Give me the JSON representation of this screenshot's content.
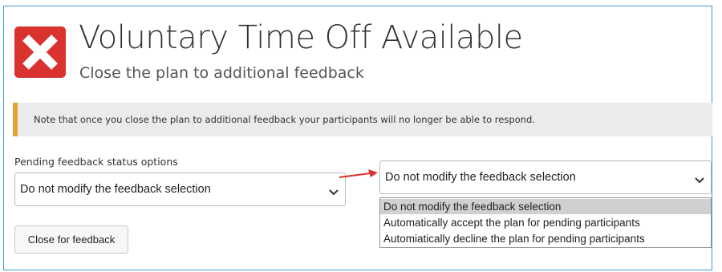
{
  "header": {
    "icon": "close-x-icon",
    "title": "Voluntary Time Off Available",
    "subtitle": "Close the plan to additional feedback"
  },
  "note": {
    "text": "Note that once you close the plan to additional feedback your participants will no longer be able to respond.",
    "accent_color": "#e0a52d"
  },
  "pending_feedback": {
    "label": "Pending feedback status options",
    "left_select_value": "Do not modify the feedback selection",
    "right_select_value": "Do not modify the feedback selection",
    "options": [
      "Do not modify the feedback selection",
      "Automatically accept the plan for pending participants",
      "Automiatically decline the plan for pending participants"
    ],
    "highlighted_option_index": 0
  },
  "actions": {
    "close_button_label": "Close for feedback"
  },
  "colors": {
    "frame_border": "#3a9bd5",
    "icon_red": "#d9322f",
    "arrow_red": "#d9322f"
  }
}
